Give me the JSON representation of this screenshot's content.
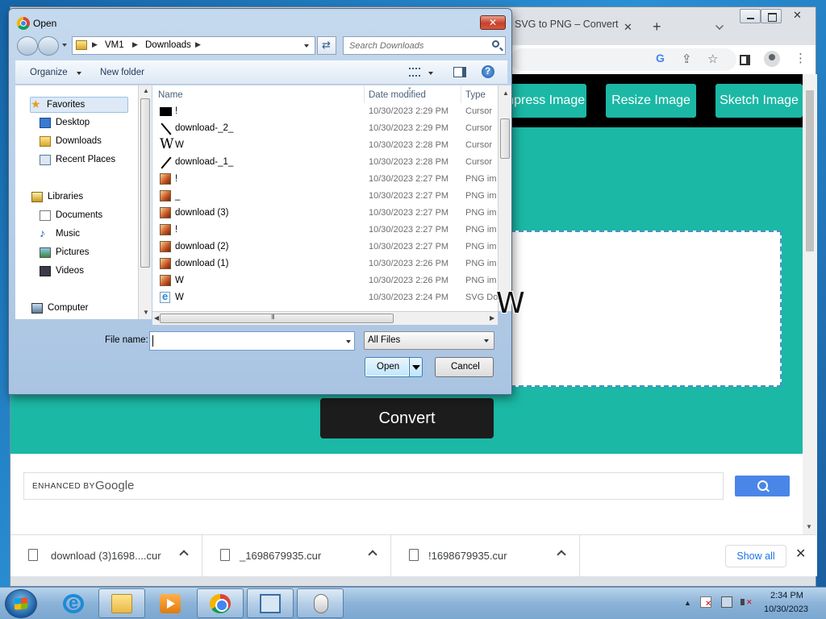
{
  "browser": {
    "tab_title": "SVG to PNG – Convert",
    "tab_close": "✕",
    "new_tab": "+",
    "menu": "⋮",
    "nav_links": [
      "ompress Image",
      "Resize Image",
      "Sketch Image"
    ],
    "convert_label": "Convert",
    "search": {
      "enhanced_by": "ENHANCED BY",
      "google": "Google"
    },
    "downloads": [
      {
        "name": "download (3)1698....cur"
      },
      {
        "name": "_1698679935.cur"
      },
      {
        "name": "!1698679935.cur"
      }
    ],
    "show_all": "Show all",
    "close_shelf": "✕"
  },
  "dialog": {
    "title": "Open",
    "breadcrumb": [
      "VM1",
      "Downloads"
    ],
    "search_placeholder": "Search Downloads",
    "commands": {
      "organize": "Organize",
      "new_folder": "New folder"
    },
    "nav_pane": {
      "favorites": "Favorites",
      "desktop": "Desktop",
      "downloads": "Downloads",
      "recent": "Recent Places",
      "libraries": "Libraries",
      "documents": "Documents",
      "music": "Music",
      "pictures": "Pictures",
      "videos": "Videos",
      "computer": "Computer"
    },
    "columns": {
      "name": "Name",
      "date": "Date modified",
      "type": "Type"
    },
    "files": [
      {
        "icon": "cursor-block-icon",
        "name": "!",
        "date": "10/30/2023 2:29 PM",
        "type": "Cursor"
      },
      {
        "icon": "cursor-back-slash-icon",
        "name": "download-_2_",
        "date": "10/30/2023 2:29 PM",
        "type": "Cursor"
      },
      {
        "icon": "cursor-w-icon",
        "name": "W",
        "date": "10/30/2023 2:28 PM",
        "type": "Cursor"
      },
      {
        "icon": "cursor-slash-icon",
        "name": "download-_1_",
        "date": "10/30/2023 2:28 PM",
        "type": "Cursor"
      },
      {
        "icon": "png-file-icon",
        "name": "!",
        "date": "10/30/2023 2:27 PM",
        "type": "PNG im"
      },
      {
        "icon": "png-file-icon",
        "name": "_",
        "date": "10/30/2023 2:27 PM",
        "type": "PNG im"
      },
      {
        "icon": "png-file-icon",
        "name": "download (3)",
        "date": "10/30/2023 2:27 PM",
        "type": "PNG im"
      },
      {
        "icon": "png-file-icon",
        "name": "!",
        "date": "10/30/2023 2:27 PM",
        "type": "PNG im"
      },
      {
        "icon": "png-file-icon",
        "name": "download (2)",
        "date": "10/30/2023 2:27 PM",
        "type": "PNG im"
      },
      {
        "icon": "png-file-icon",
        "name": "download (1)",
        "date": "10/30/2023 2:26 PM",
        "type": "PNG im"
      },
      {
        "icon": "png-file-icon",
        "name": "W",
        "date": "10/30/2023 2:26 PM",
        "type": "PNG im"
      },
      {
        "icon": "svg-file-icon",
        "name": "W",
        "date": "10/30/2023 2:24 PM",
        "type": "SVG Do"
      }
    ],
    "file_name_label": "File name:",
    "file_name_value": "",
    "filter": "All Files",
    "open": "Open",
    "cancel": "Cancel"
  },
  "cursor_overlay": "W",
  "taskbar": {
    "time": "2:34 PM",
    "date": "10/30/2023"
  }
}
